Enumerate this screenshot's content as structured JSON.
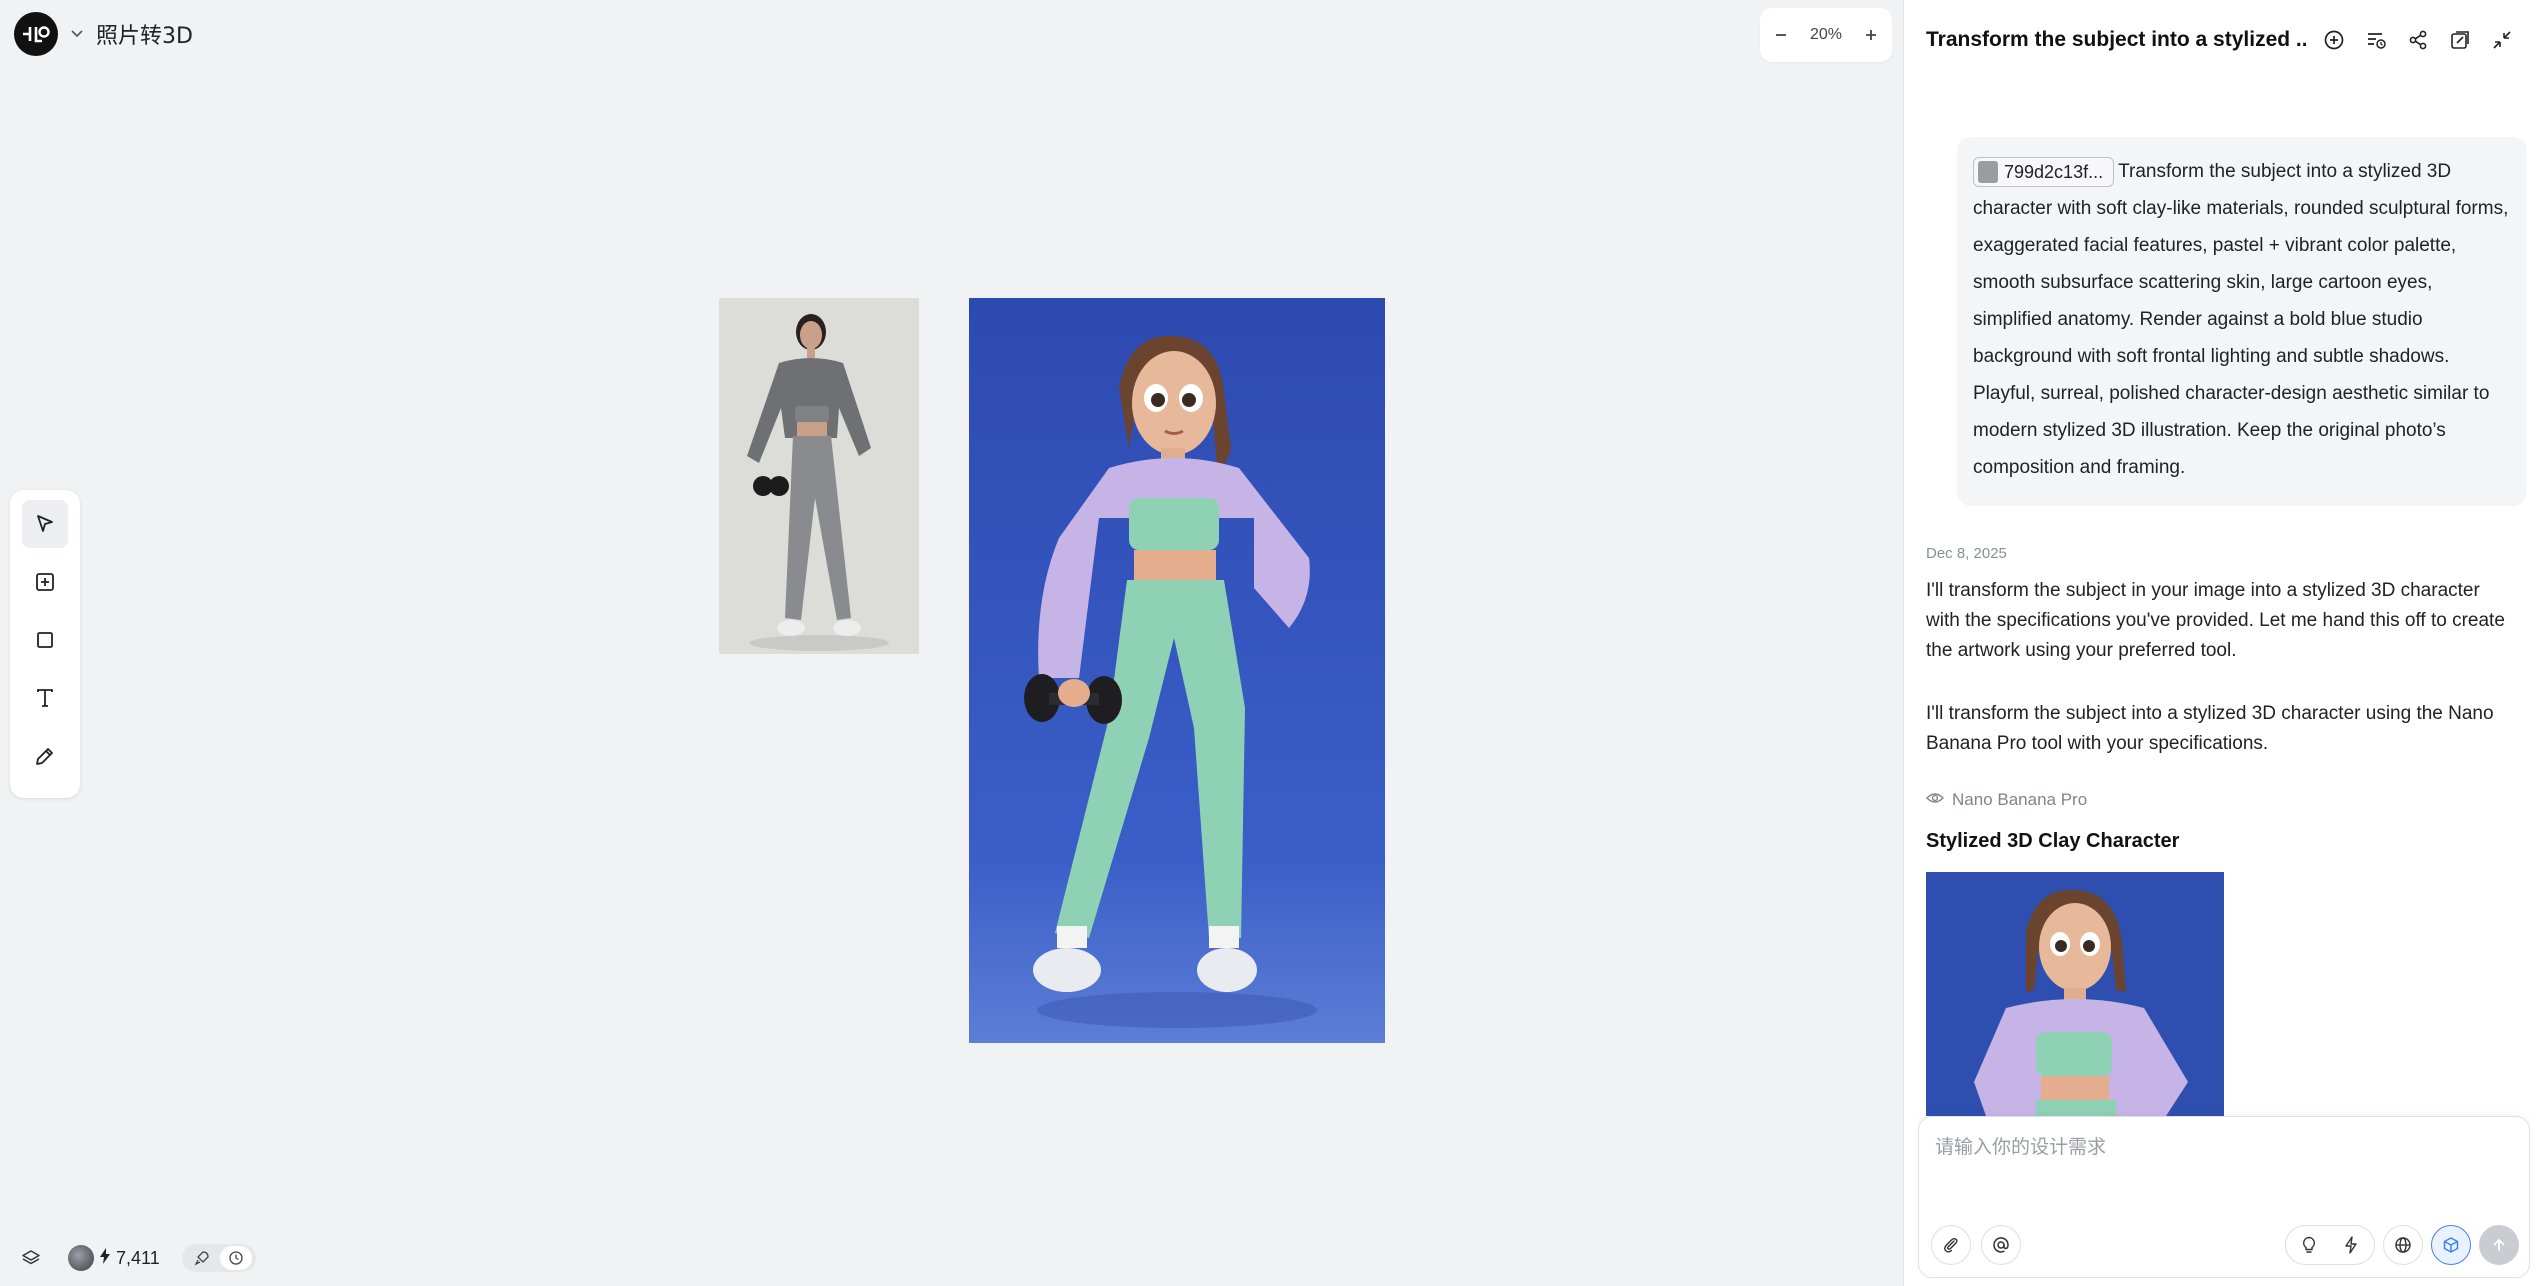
{
  "project": {
    "name": "照片转3D"
  },
  "zoom": {
    "level": "20%"
  },
  "toolbar": {
    "tools": [
      "select-tool",
      "add-frame-tool",
      "rectangle-tool",
      "text-tool",
      "pen-tool"
    ],
    "active": "select-tool"
  },
  "status": {
    "credits": "7,411"
  },
  "panel": {
    "title": "Transform the subject into a stylized ...",
    "user_message": {
      "chip": "799d2c13f...",
      "text": "Transform the subject into a stylized 3D character with soft clay-like materials, rounded sculptural forms, exaggerated facial features, pastel + vibrant color palette, smooth subsurface scattering skin, large cartoon eyes, simplified anatomy. Render against a bold blue studio background with soft frontal lighting and subtle shadows. Playful, surreal, polished character-design aesthetic similar to modern stylized 3D illustration. Keep the original photo’s composition and framing."
    },
    "date": "Dec 8, 2025",
    "reply1": "I'll transform the subject in your image into a stylized 3D character with the specifications you've provided. Let me hand this off to create the artwork using your preferred tool.",
    "reply2": "I'll transform the subject into a stylized 3D character using the Nano Banana Pro tool with your specifications.",
    "tool_name": "Nano Banana Pro",
    "result_title": "Stylized 3D Clay Character"
  },
  "composer": {
    "placeholder": "请输入你的设计需求"
  },
  "colors": {
    "accent": "#3b82f6",
    "canvas_bg": "#f1f2f4",
    "blue_bg": "#2f4fb0"
  }
}
